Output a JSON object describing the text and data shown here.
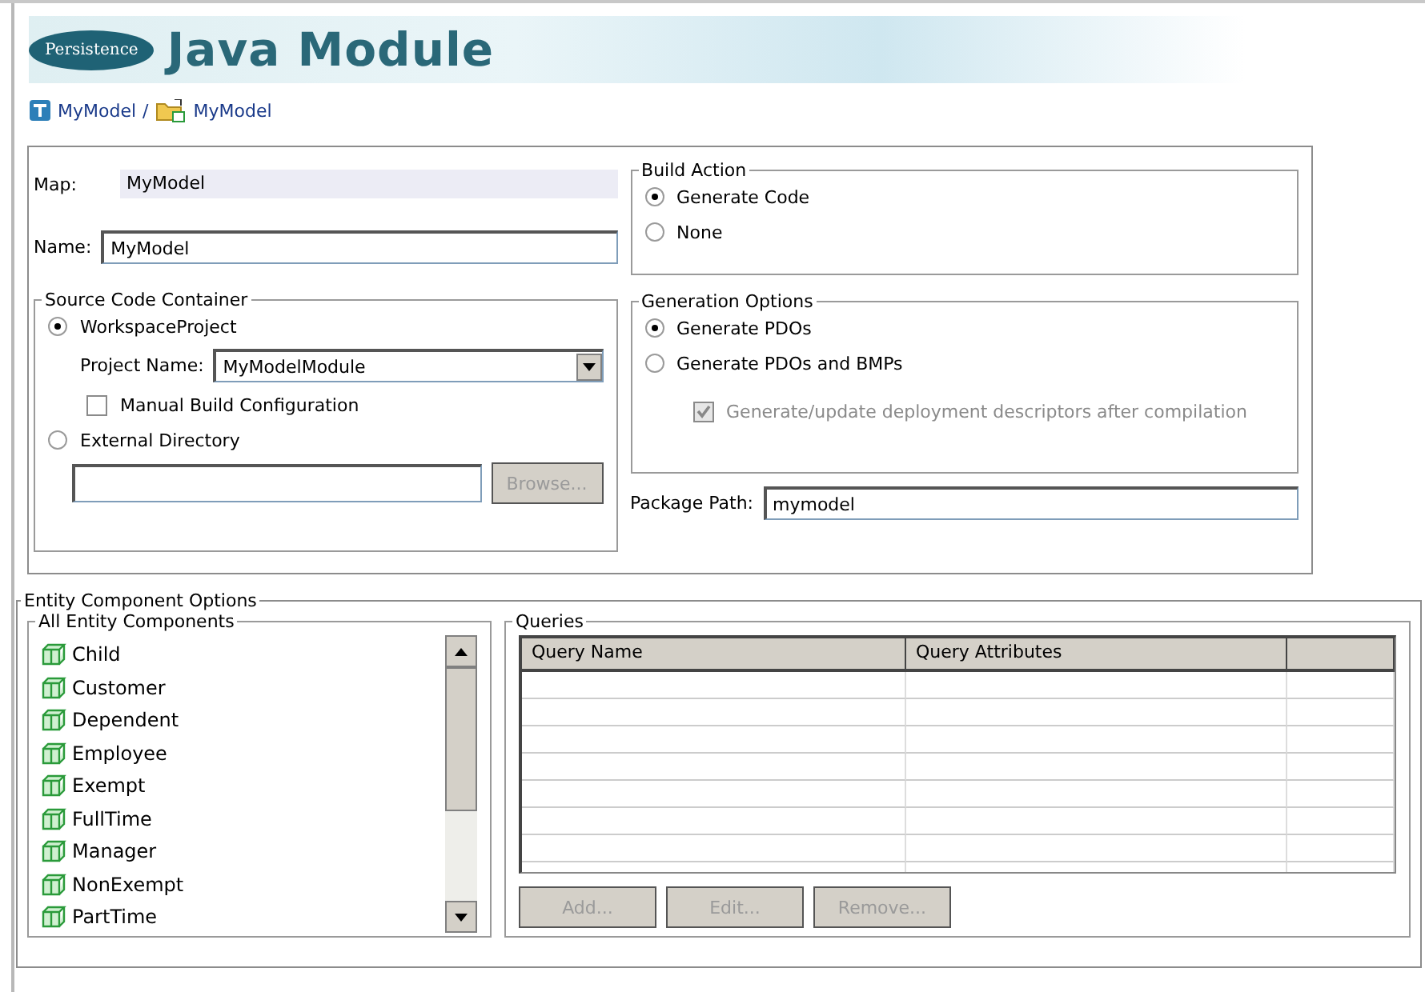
{
  "header": {
    "logo": "Persistence",
    "title": "Java Module"
  },
  "breadcrumb": {
    "items": [
      {
        "label": "MyModel",
        "kind": "model"
      },
      {
        "label": "MyModel",
        "kind": "module"
      }
    ],
    "separator": "/"
  },
  "map": {
    "label": "Map:",
    "value": "MyModel"
  },
  "name": {
    "label": "Name:",
    "value": "MyModel"
  },
  "source_code_container": {
    "title": "Source Code Container",
    "options": [
      {
        "label": "WorkspaceProject",
        "selected": true
      },
      {
        "label": "External Directory",
        "selected": false
      }
    ],
    "project_name": {
      "label": "Project Name:",
      "value": "MyModelModule"
    },
    "manual_build": {
      "label": "Manual Build Configuration",
      "checked": false
    },
    "browse_button": {
      "label": "Browse...",
      "disabled": true
    }
  },
  "build_action": {
    "title": "Build Action",
    "options": [
      {
        "label": "Generate Code",
        "selected": true
      },
      {
        "label": "None",
        "selected": false
      }
    ]
  },
  "generation_options": {
    "title": "Generation Options",
    "options": [
      {
        "label": "Generate PDOs",
        "selected": true
      },
      {
        "label": "Generate PDOs and BMPs",
        "selected": false
      }
    ],
    "descriptors": {
      "label": "Generate/update deployment descriptors after compilation",
      "checked": true,
      "disabled": true
    }
  },
  "package_path": {
    "label": "Package Path:",
    "value": "mymodel"
  },
  "entity_component_options": {
    "title": "Entity Component Options",
    "all_entity_components": {
      "title": "All Entity Components",
      "items": [
        "Child",
        "Customer",
        "Dependent",
        "Employee",
        "Exempt",
        "FullTime",
        "Manager",
        "NonExempt",
        "PartTime"
      ]
    },
    "queries": {
      "title": "Queries",
      "columns": [
        "Query Name",
        "Query Attributes"
      ],
      "buttons": [
        {
          "label": "Add...",
          "disabled": true
        },
        {
          "label": "Edit...",
          "disabled": true
        },
        {
          "label": "Remove...",
          "disabled": true
        }
      ]
    }
  }
}
